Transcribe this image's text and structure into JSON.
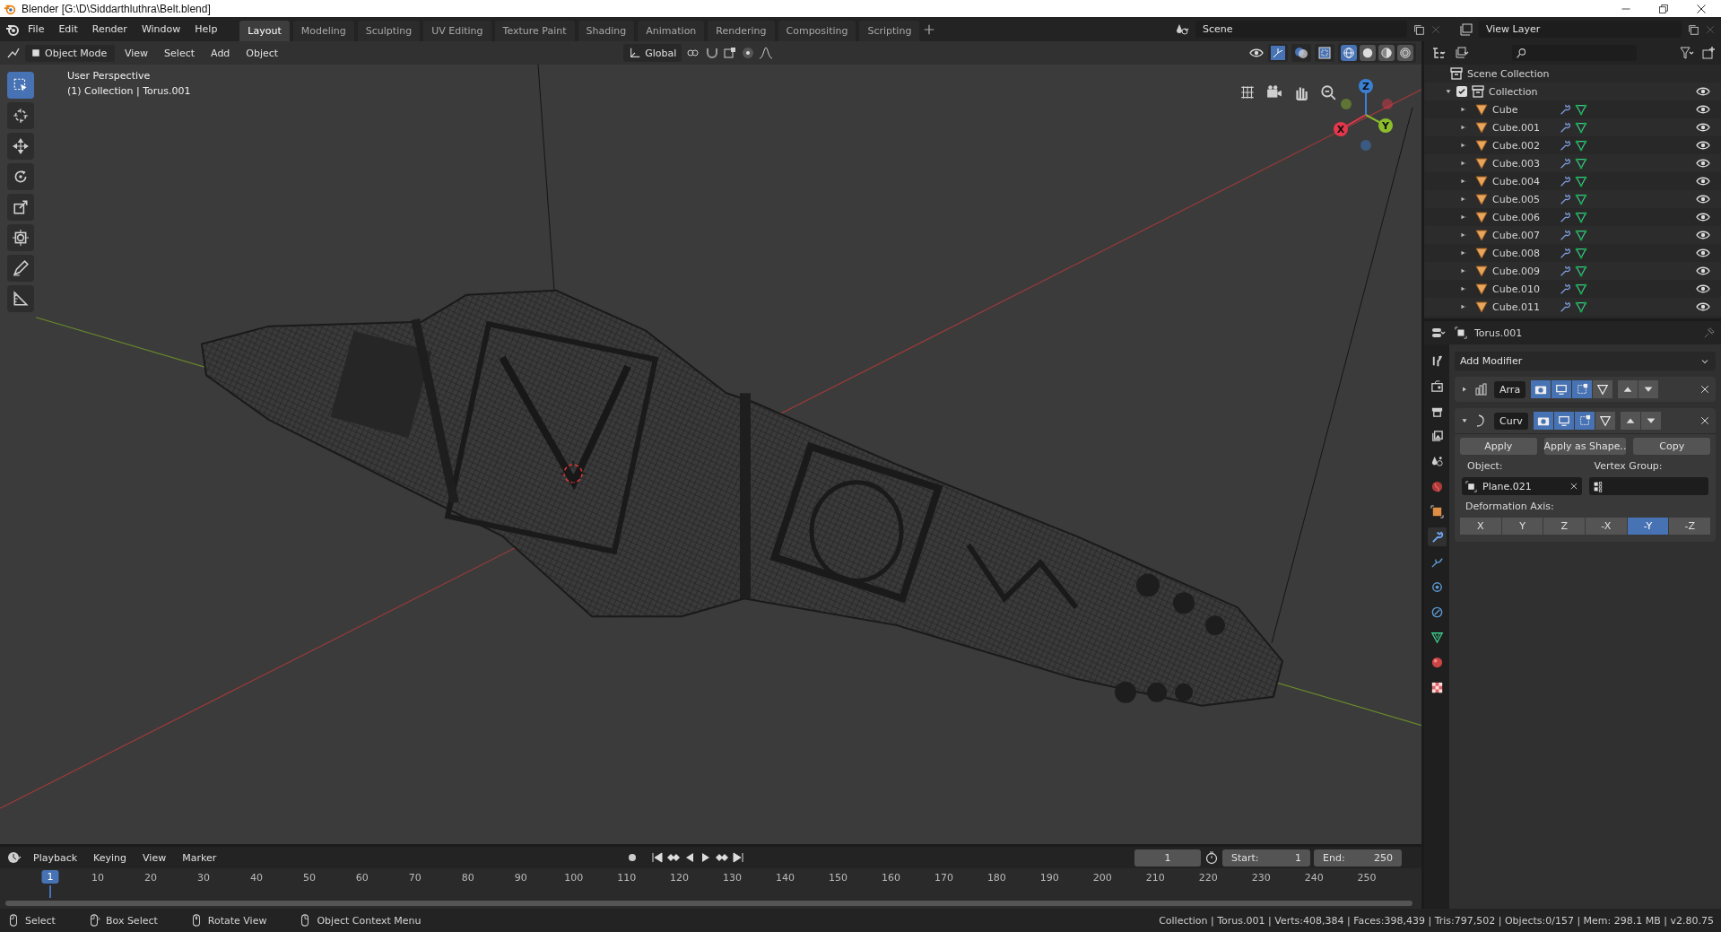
{
  "window": {
    "title": "Blender [G:\\D\\Siddarthluthra\\Belt.blend]"
  },
  "menu": [
    "File",
    "Edit",
    "Render",
    "Window",
    "Help"
  ],
  "workspaces": [
    {
      "label": "Layout",
      "selected": true
    },
    {
      "label": "Modeling",
      "selected": false
    },
    {
      "label": "Sculpting",
      "selected": false
    },
    {
      "label": "UV Editing",
      "selected": false
    },
    {
      "label": "Texture Paint",
      "selected": false
    },
    {
      "label": "Shading",
      "selected": false
    },
    {
      "label": "Animation",
      "selected": false
    },
    {
      "label": "Rendering",
      "selected": false
    },
    {
      "label": "Compositing",
      "selected": false
    },
    {
      "label": "Scripting",
      "selected": false
    }
  ],
  "scene": {
    "name": "Scene"
  },
  "view_layer": {
    "name": "View Layer"
  },
  "viewport": {
    "mode": "Object Mode",
    "menus": [
      "View",
      "Select",
      "Add",
      "Object"
    ],
    "orientation": "Global",
    "shading_modes": [
      {
        "kind": "wireframe",
        "selected": true
      },
      {
        "kind": "solid",
        "selected": false
      },
      {
        "kind": "material",
        "selected": false
      },
      {
        "kind": "rendered",
        "selected": false
      }
    ],
    "tools": [
      {
        "kind": "select",
        "selected": true
      },
      {
        "kind": "cursor",
        "selected": false
      },
      {
        "kind": "move",
        "selected": false
      },
      {
        "kind": "rotate",
        "selected": false
      },
      {
        "kind": "scale",
        "selected": false
      },
      {
        "kind": "transform",
        "selected": false
      },
      {
        "kind": "annotate",
        "selected": false
      },
      {
        "kind": "measure",
        "selected": false
      }
    ],
    "info": [
      "User Perspective",
      "(1) Collection | Torus.001"
    ],
    "gizmo_axes": [
      {
        "label": "X",
        "color": "#e5374b"
      },
      {
        "label": "Y",
        "color": "#8bbd2c"
      },
      {
        "label": "Z",
        "color": "#3a81d6"
      }
    ]
  },
  "outliner": {
    "root": "Scene Collection",
    "collection": {
      "label": "Collection",
      "checked": true,
      "expanded": true,
      "children": [
        {
          "label": "Cube",
          "visible": true
        },
        {
          "label": "Cube.001",
          "visible": true
        },
        {
          "label": "Cube.002",
          "visible": true
        },
        {
          "label": "Cube.003",
          "visible": true
        },
        {
          "label": "Cube.004",
          "visible": true
        },
        {
          "label": "Cube.005",
          "visible": true
        },
        {
          "label": "Cube.006",
          "visible": true
        },
        {
          "label": "Cube.007",
          "visible": true
        },
        {
          "label": "Cube.008",
          "visible": true
        },
        {
          "label": "Cube.009",
          "visible": true
        },
        {
          "label": "Cube.010",
          "visible": true
        },
        {
          "label": "Cube.011",
          "visible": true
        }
      ]
    }
  },
  "properties": {
    "tabs": [
      {
        "kind": "tool",
        "selected": false
      },
      {
        "kind": "render",
        "selected": false
      },
      {
        "kind": "output",
        "selected": false
      },
      {
        "kind": "view_layer",
        "selected": false
      },
      {
        "kind": "scene",
        "selected": false
      },
      {
        "kind": "world",
        "selected": false
      },
      {
        "kind": "object",
        "selected": false
      },
      {
        "kind": "modifiers",
        "selected": true
      },
      {
        "kind": "particles",
        "selected": false
      },
      {
        "kind": "physics",
        "selected": false
      },
      {
        "kind": "constraints",
        "selected": false
      },
      {
        "kind": "data",
        "selected": false
      },
      {
        "kind": "material",
        "selected": false
      },
      {
        "kind": "texture",
        "selected": false
      }
    ],
    "object": "Torus.001",
    "add_modifier": "Add Modifier",
    "modifiers": [
      {
        "kind": "array",
        "name": "Arra",
        "expanded": false,
        "toggles": [
          true,
          true,
          true,
          false
        ]
      },
      {
        "kind": "curve",
        "name": "Curv",
        "expanded": true,
        "toggles": [
          true,
          true,
          true,
          false
        ]
      }
    ],
    "actions": [
      "Apply",
      "Apply as Shape..",
      "Copy"
    ],
    "object_label": "Object:",
    "object_value": "Plane.021",
    "vertex_group_label": "Vertex Group:",
    "axis_label": "Deformation Axis:",
    "axes": [
      {
        "label": "X",
        "selected": false
      },
      {
        "label": "Y",
        "selected": false
      },
      {
        "label": "Z",
        "selected": false
      },
      {
        "label": "-X",
        "selected": false
      },
      {
        "label": "-Y",
        "selected": true
      },
      {
        "label": "-Z",
        "selected": false
      }
    ]
  },
  "timeline": {
    "menus": [
      "Playback",
      "Keying",
      "View",
      "Marker"
    ],
    "current_frame": "1",
    "start_label": "Start:",
    "start": "1",
    "end_label": "End:",
    "end": "250",
    "playhead": "1",
    "ticks": [
      "10",
      "20",
      "30",
      "40",
      "50",
      "60",
      "70",
      "80",
      "90",
      "100",
      "110",
      "120",
      "130",
      "140",
      "150",
      "160",
      "170",
      "180",
      "190",
      "200",
      "210",
      "220",
      "230",
      "240",
      "250"
    ]
  },
  "status_bar": {
    "hints": [
      {
        "kind": "left",
        "label": "Select"
      },
      {
        "kind": "drag",
        "label": "Box Select"
      },
      {
        "kind": "middle",
        "label": "Rotate View"
      },
      {
        "kind": "right",
        "label": "Object Context Menu"
      }
    ],
    "stats": "Collection | Torus.001 | Verts:408,384 | Faces:398,439 | Tris:797,502 | Objects:0/157 | Mem: 298.1 MB | v2.80.75"
  }
}
